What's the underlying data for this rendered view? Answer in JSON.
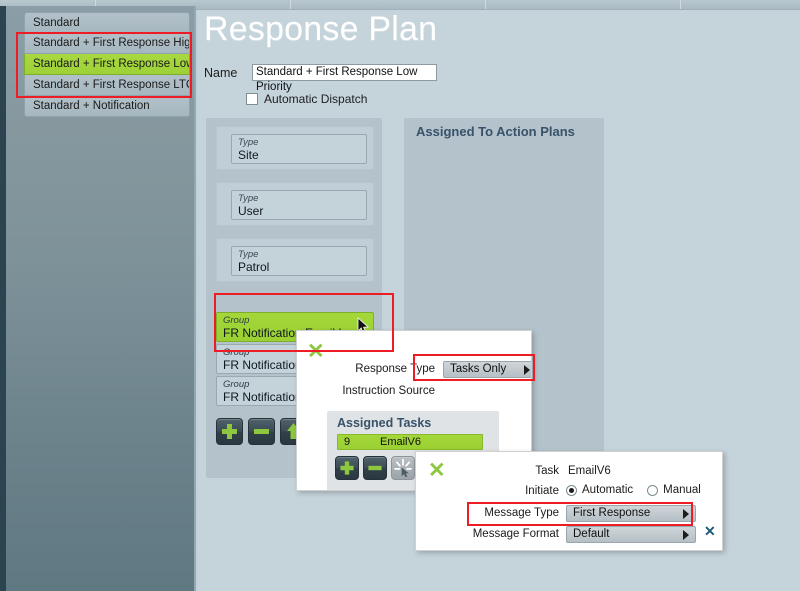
{
  "window": {
    "title": "Response Plan",
    "tab_dividers": [
      95,
      290,
      485,
      680
    ]
  },
  "sidebar": {
    "items": [
      {
        "label": "Standard",
        "selected": false
      },
      {
        "label": "Standard + First Response High",
        "selected": false
      },
      {
        "label": "Standard + First Response Low I",
        "selected": true
      },
      {
        "label": "Standard + First Response LTC",
        "selected": false
      },
      {
        "label": "Standard + Notification",
        "selected": false
      }
    ]
  },
  "form": {
    "name_label": "Name",
    "name_value": "Standard + First Response Low Priority",
    "auto_dispatch_label": "Automatic Dispatch",
    "auto_dispatch_checked": false
  },
  "stack": {
    "rows": [
      {
        "type_label": "Type",
        "value": "Site"
      },
      {
        "type_label": "Type",
        "value": "User"
      },
      {
        "type_label": "Type",
        "value": "Patrol"
      }
    ]
  },
  "groups": {
    "rows": [
      {
        "type_label": "Group",
        "value": "FR Notification Email Low",
        "selected": true,
        "icon": "cursor-pointer-icon"
      },
      {
        "type_label": "Group",
        "value": "FR Notification",
        "selected": false
      },
      {
        "type_label": "Group",
        "value": "FR Notification",
        "selected": false
      }
    ],
    "buttons": [
      {
        "name": "add-group-button",
        "icon": "plus-icon"
      },
      {
        "name": "remove-group-button",
        "icon": "minus-icon"
      },
      {
        "name": "move-up-group-button",
        "icon": "arrow-up-icon"
      }
    ]
  },
  "assigned_panel": {
    "header": "Assigned To Action Plans"
  },
  "dialog1": {
    "close_glyph": "✕",
    "response_type_label": "Response Type",
    "response_type_value": "Tasks Only",
    "instruction_source_label": "Instruction Source",
    "tasks": {
      "header": "Assigned Tasks",
      "rows": [
        {
          "number": "9",
          "name": "EmailV6"
        }
      ],
      "buttons": [
        {
          "name": "add-task-button",
          "icon": "plus-icon",
          "disabled": false
        },
        {
          "name": "remove-task-button",
          "icon": "minus-icon",
          "disabled": false
        },
        {
          "name": "test-task-button",
          "icon": "sparkle-icon",
          "disabled": true
        }
      ]
    }
  },
  "dialog2": {
    "close_glyph": "✕",
    "task_label": "Task",
    "task_value": "EmailV6",
    "initiate_label": "Initiate",
    "initiate_automatic": "Automatic",
    "initiate_manual": "Manual",
    "initiate_selected": "Automatic",
    "message_type_label": "Message Type",
    "message_type_value": "First Response",
    "message_format_label": "Message Format",
    "message_format_value": "Default",
    "clear_format_glyph": "✕"
  },
  "highlights": {
    "color": "#ee1c24",
    "boxes": [
      "sidebar-response-plans",
      "group-list",
      "response-type-combo",
      "message-type-combo"
    ]
  },
  "colors": {
    "accent_green": "#9ad032",
    "page_bg": "#c5d3db",
    "sidebar_dark": "#2b4450",
    "header_text": "#37526a",
    "highlight_red": "#ee1c24"
  }
}
